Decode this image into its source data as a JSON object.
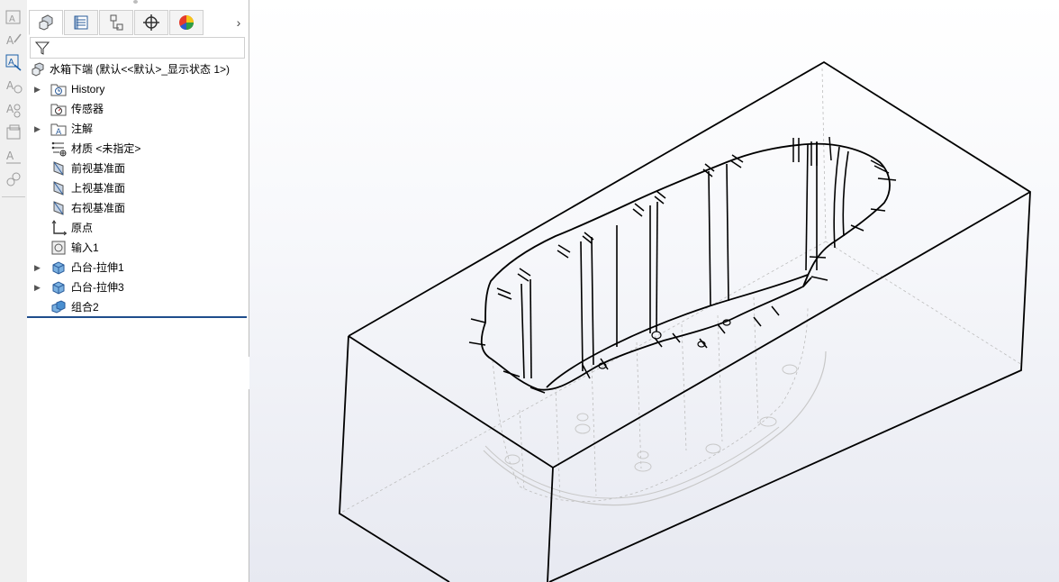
{
  "window": {
    "background_top": "#ffffff",
    "background_bottom": "#e7e9f1",
    "accent": "#1f4e8c"
  },
  "left_toolbar": {
    "icons": [
      "smart-dimension-icon",
      "note-icon",
      "annotation-icon",
      "balloon-icon",
      "auto-balloon-icon",
      "surface-finish-icon",
      "weld-symbol-icon",
      "hole-callout-icon"
    ]
  },
  "feature_manager": {
    "tabs": [
      "feature-manager-tab",
      "property-manager-tab",
      "configuration-manager-tab",
      "dimxpert-manager-tab",
      "display-manager-tab"
    ],
    "active_tab": 0,
    "more_chevron": "›",
    "filter_icon": "filter-icon",
    "root": {
      "label": "水箱下端  (默认<<默认>_显示状态 1>)"
    },
    "items": [
      {
        "label": "History",
        "icon": "history-icon",
        "expandable": true
      },
      {
        "label": "传感器",
        "icon": "sensor-icon",
        "expandable": false
      },
      {
        "label": "注解",
        "icon": "annotations-icon",
        "expandable": true
      },
      {
        "label": "材质 <未指定>",
        "icon": "material-icon",
        "expandable": false
      },
      {
        "label": "前视基准面",
        "icon": "plane-icon",
        "expandable": false
      },
      {
        "label": "上视基准面",
        "icon": "plane-icon",
        "expandable": false
      },
      {
        "label": "右视基准面",
        "icon": "plane-icon",
        "expandable": false
      },
      {
        "label": "原点",
        "icon": "origin-icon",
        "expandable": false
      },
      {
        "label": "输入1",
        "icon": "imported-body-icon",
        "expandable": false
      },
      {
        "label": "凸台-拉伸1",
        "icon": "boss-extrude-icon",
        "expandable": true
      },
      {
        "label": "凸台-拉伸3",
        "icon": "boss-extrude-icon",
        "expandable": true
      },
      {
        "label": "组合2",
        "icon": "combine-icon",
        "expandable": false
      }
    ]
  },
  "graphics_area": {
    "model": "box-with-cavity-wireframe"
  }
}
